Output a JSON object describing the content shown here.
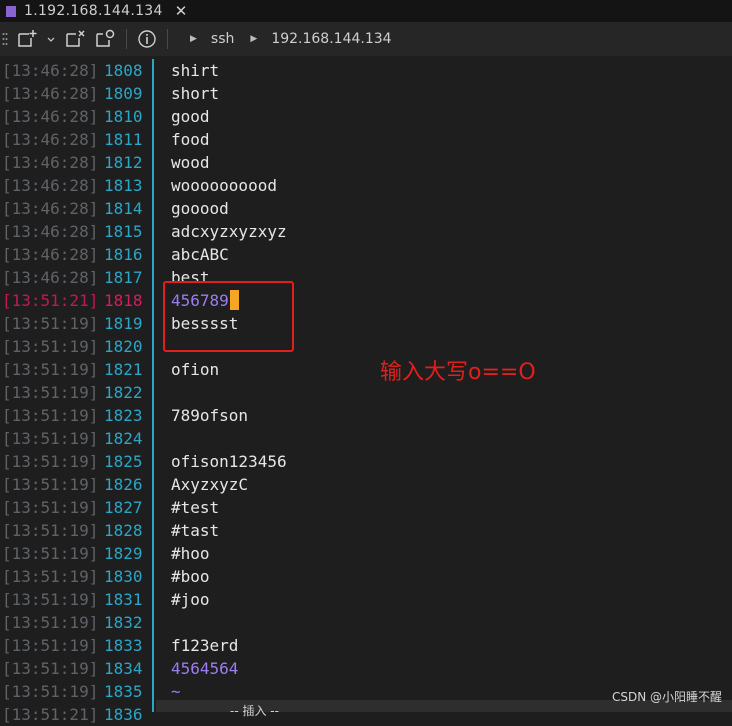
{
  "tab": {
    "title": "1.192.168.144.134",
    "close": "✕"
  },
  "toolbar": {
    "info_icon": "ⓘ",
    "crumbs": [
      "ssh",
      "192.168.144.134"
    ]
  },
  "lines": [
    {
      "ts": "[13:46:28]",
      "ln": "1808",
      "text": "shirt"
    },
    {
      "ts": "[13:46:28]",
      "ln": "1809",
      "text": "short"
    },
    {
      "ts": "[13:46:28]",
      "ln": "1810",
      "text": "good"
    },
    {
      "ts": "[13:46:28]",
      "ln": "1811",
      "text": "food"
    },
    {
      "ts": "[13:46:28]",
      "ln": "1812",
      "text": "wood"
    },
    {
      "ts": "[13:46:28]",
      "ln": "1813",
      "text": "woooooooood"
    },
    {
      "ts": "[13:46:28]",
      "ln": "1814",
      "text": "gooood"
    },
    {
      "ts": "[13:46:28]",
      "ln": "1815",
      "text": "adcxyzxyzxyz"
    },
    {
      "ts": "[13:46:28]",
      "ln": "1816",
      "text": "abcABC"
    },
    {
      "ts": "[13:46:28]",
      "ln": "1817",
      "text": "best"
    },
    {
      "ts": "[13:51:21]",
      "ln": "1818",
      "text": "456789",
      "current": true
    },
    {
      "ts": "[13:51:19]",
      "ln": "1819",
      "text": "besssst"
    },
    {
      "ts": "[13:51:19]",
      "ln": "1820",
      "text": ""
    },
    {
      "ts": "[13:51:19]",
      "ln": "1821",
      "text": "ofion"
    },
    {
      "ts": "[13:51:19]",
      "ln": "1822",
      "text": ""
    },
    {
      "ts": "[13:51:19]",
      "ln": "1823",
      "text": "789ofson"
    },
    {
      "ts": "[13:51:19]",
      "ln": "1824",
      "text": ""
    },
    {
      "ts": "[13:51:19]",
      "ln": "1825",
      "text": "ofison123456"
    },
    {
      "ts": "[13:51:19]",
      "ln": "1826",
      "text": "AxyzxyzC"
    },
    {
      "ts": "[13:51:19]",
      "ln": "1827",
      "text": "#test"
    },
    {
      "ts": "[13:51:19]",
      "ln": "1828",
      "text": "#tast"
    },
    {
      "ts": "[13:51:19]",
      "ln": "1829",
      "text": "#hoo"
    },
    {
      "ts": "[13:51:19]",
      "ln": "1830",
      "text": "#boo"
    },
    {
      "ts": "[13:51:19]",
      "ln": "1831",
      "text": "#joo"
    },
    {
      "ts": "[13:51:19]",
      "ln": "1832",
      "text": ""
    },
    {
      "ts": "[13:51:19]",
      "ln": "1833",
      "text": "f123erd"
    },
    {
      "ts": "[13:51:19]",
      "ln": "1834",
      "text": "4564564",
      "violet": true
    },
    {
      "ts": "[13:51:19]",
      "ln": "1835",
      "text": "~",
      "violet": true
    },
    {
      "ts": "[13:51:21]",
      "ln": "1836",
      "text": ""
    }
  ],
  "annotation": "输入大写o==O",
  "status": "-- 插入 --",
  "watermark": "CSDN @小阳睡不醒",
  "colors": {
    "accent": "#2aa6c8",
    "current": "#d81b60",
    "cursor": "#f5a623",
    "annotation": "#e0201c",
    "tab_marker": "#8a63d2"
  }
}
